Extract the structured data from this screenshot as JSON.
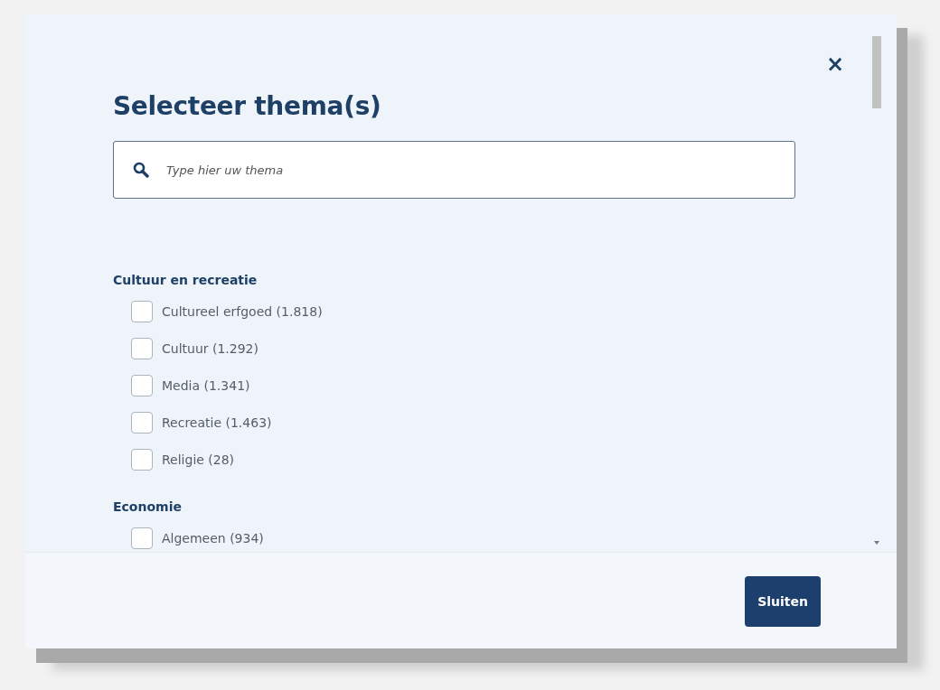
{
  "dialog": {
    "title": "Selecteer thema(s)",
    "close": "×",
    "search": {
      "placeholder": "Type hier uw thema"
    },
    "groups": [
      {
        "title": "Cultuur en recreatie",
        "options": [
          {
            "label": "Cultureel erfgoed (1.818)",
            "checked": false
          },
          {
            "label": "Cultuur (1.292)",
            "checked": false
          },
          {
            "label": "Media (1.341)",
            "checked": false
          },
          {
            "label": "Recreatie (1.463)",
            "checked": false
          },
          {
            "label": "Religie (28)",
            "checked": false
          }
        ]
      },
      {
        "title": "Economie",
        "options": [
          {
            "label": "Algemeen (934)",
            "checked": false
          }
        ]
      }
    ],
    "buttons": [
      "Sluiten"
    ]
  }
}
